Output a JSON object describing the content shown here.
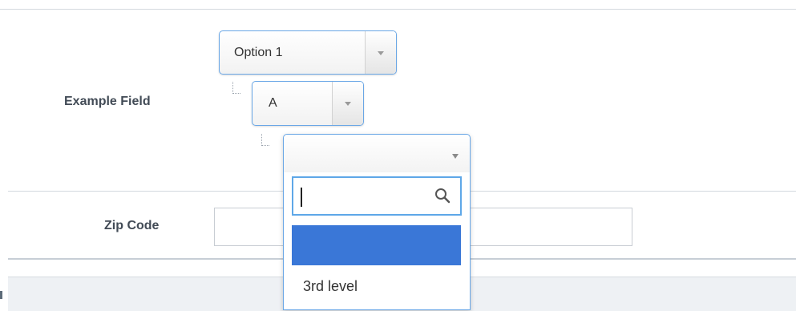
{
  "form": {
    "example_field": {
      "label": "Example Field",
      "level1": {
        "value": "Option 1"
      },
      "level2": {
        "value": "A"
      },
      "level3": {
        "value": "",
        "search": {
          "value": "",
          "placeholder": ""
        },
        "options": [
          {
            "label": "",
            "highlighted": true
          },
          {
            "label": "3rd level",
            "highlighted": false
          }
        ]
      }
    },
    "zip_code": {
      "label": "Zip Code",
      "value": "",
      "placeholder": ""
    }
  },
  "icons": {
    "dropdown_arrow": "triangle-down",
    "search": "magnifier"
  },
  "colors": {
    "accent": "#3a77d7",
    "focus_border": "#5ea7e8",
    "label_text": "#424b56"
  }
}
